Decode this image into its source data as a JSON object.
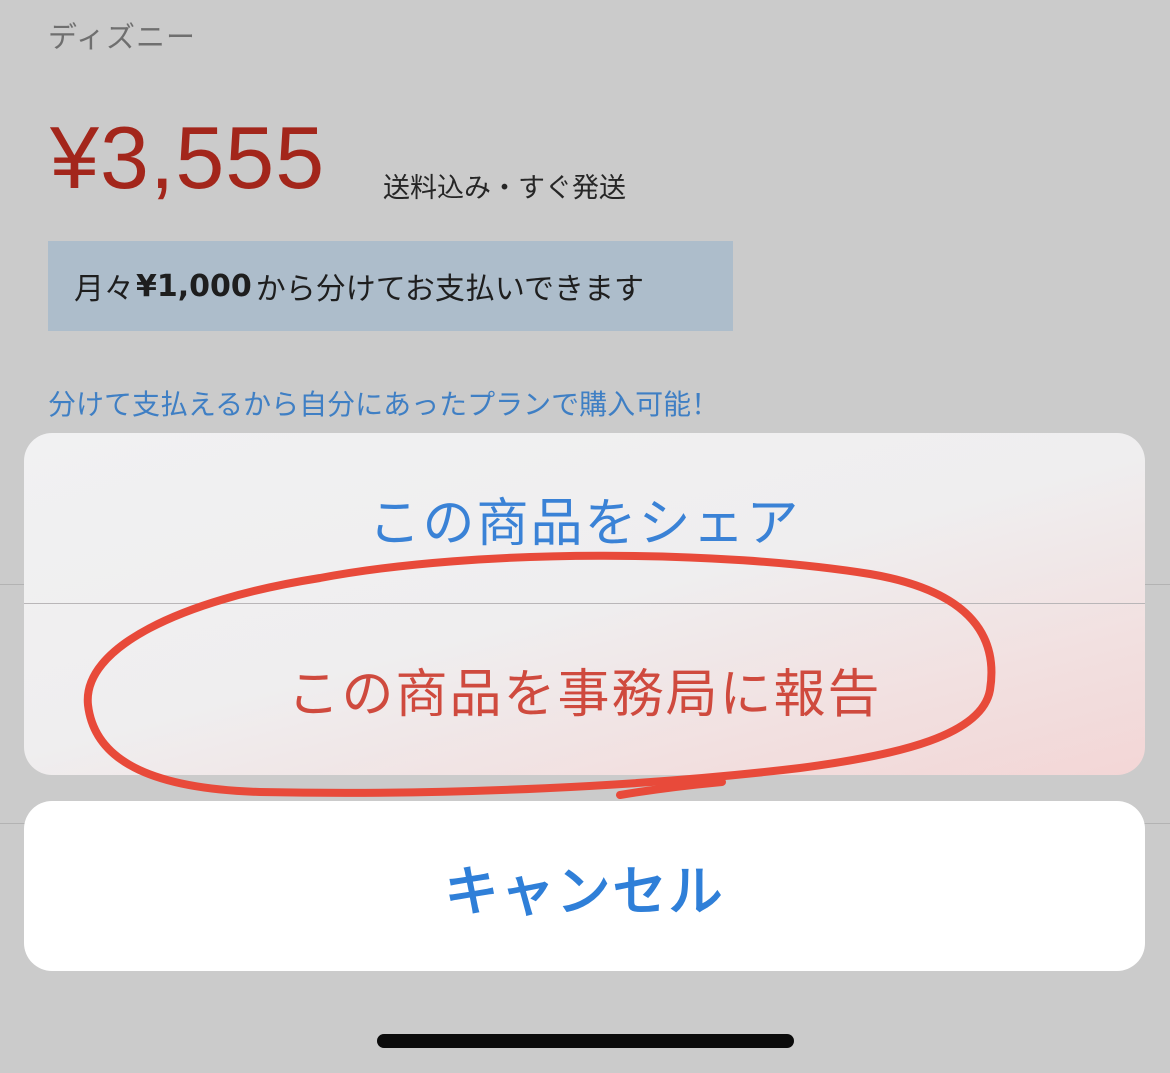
{
  "product": {
    "brand": "ディズニー",
    "price": "¥3,555",
    "shipping_note": "送料込み・すぐ発送",
    "installment": {
      "prefix": "月々",
      "amount": "¥1,000",
      "suffix": "から分けてお支払いできます"
    },
    "promo_link": "分けて支払えるから自分にあったプランで購入可能！"
  },
  "action_sheet": {
    "share_label": "この商品をシェア",
    "report_label": "この商品を事務局に報告",
    "cancel_label": "キャンセル"
  },
  "colors": {
    "price": "#a3261b",
    "link_blue": "#3a82d6",
    "report_red": "#cf4a3e",
    "annotation_red": "#e84a3a",
    "installment_bg": "#adbdcb"
  },
  "annotation": {
    "shape": "hand-drawn ellipse around report option"
  }
}
